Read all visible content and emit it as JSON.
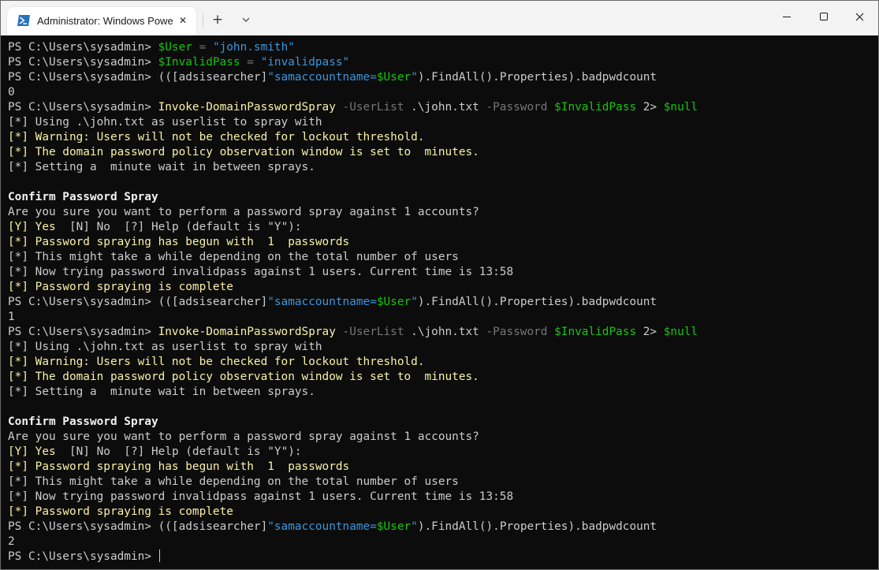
{
  "window": {
    "tab_title": "Administrator: Windows Powe",
    "new_tab_glyph": "+",
    "close_tab_glyph": "✕",
    "icons": [
      "powershell-icon",
      "close-icon",
      "plus-icon",
      "chevron-down-icon",
      "minimize-icon",
      "maximize-icon",
      "close-icon"
    ]
  },
  "terminal": {
    "lines": [
      [
        {
          "t": "PS C:\\Users\\sysadmin> ",
          "c": "default"
        },
        {
          "t": "$User",
          "c": "var"
        },
        {
          "t": " = ",
          "c": "op"
        },
        {
          "t": "\"john.smith\"",
          "c": "str"
        }
      ],
      [
        {
          "t": "PS C:\\Users\\sysadmin> ",
          "c": "default"
        },
        {
          "t": "$InvalidPass",
          "c": "var"
        },
        {
          "t": " = ",
          "c": "op"
        },
        {
          "t": "\"invalidpass\"",
          "c": "str"
        }
      ],
      [
        {
          "t": "PS C:\\Users\\sysadmin> (([adsisearcher]",
          "c": "default"
        },
        {
          "t": "\"samaccountname=",
          "c": "str"
        },
        {
          "t": "$User",
          "c": "var"
        },
        {
          "t": "\"",
          "c": "str"
        },
        {
          "t": ").FindAll().Properties).badpwdcount",
          "c": "default"
        }
      ],
      [
        {
          "t": "0",
          "c": "default"
        }
      ],
      [
        {
          "t": "PS C:\\Users\\sysadmin> ",
          "c": "default"
        },
        {
          "t": "Invoke-DomainPasswordSpray",
          "c": "cmd"
        },
        {
          "t": " -UserList",
          "c": "param"
        },
        {
          "t": " .\\john.txt ",
          "c": "default"
        },
        {
          "t": "-Password",
          "c": "param"
        },
        {
          "t": " ",
          "c": "default"
        },
        {
          "t": "$InvalidPass",
          "c": "var"
        },
        {
          "t": " 2> ",
          "c": "default"
        },
        {
          "t": "$null",
          "c": "var"
        }
      ],
      [
        {
          "t": "[*] Using .\\john.txt as userlist to spray with",
          "c": "default"
        }
      ],
      [
        {
          "t": "[*] Warning: Users will not be checked for lockout threshold.",
          "c": "warn"
        }
      ],
      [
        {
          "t": "[*] The domain password policy observation window is set to  minutes.",
          "c": "warn"
        }
      ],
      [
        {
          "t": "[*] Setting a  minute wait in between sprays.",
          "c": "default"
        }
      ],
      [
        {
          "t": "",
          "c": "default"
        }
      ],
      [
        {
          "t": "Confirm Password Spray",
          "c": "bold"
        }
      ],
      [
        {
          "t": "Are you sure you want to perform a password spray against 1 accounts?",
          "c": "default"
        }
      ],
      [
        {
          "t": "[Y] Yes  ",
          "c": "warn"
        },
        {
          "t": "[N] No  [?] Help (default is \"Y\"):",
          "c": "default"
        }
      ],
      [
        {
          "t": "[*] Password spraying has begun with  1  passwords",
          "c": "warn"
        }
      ],
      [
        {
          "t": "[*] This might take a while depending on the total number of users",
          "c": "default"
        }
      ],
      [
        {
          "t": "[*] Now trying password invalidpass against 1 users. Current time is 13:58",
          "c": "default"
        }
      ],
      [
        {
          "t": "[*] Password spraying is complete",
          "c": "warn"
        }
      ],
      [
        {
          "t": "PS C:\\Users\\sysadmin> (([adsisearcher]",
          "c": "default"
        },
        {
          "t": "\"samaccountname=",
          "c": "str"
        },
        {
          "t": "$User",
          "c": "var"
        },
        {
          "t": "\"",
          "c": "str"
        },
        {
          "t": ").FindAll().Properties).badpwdcount",
          "c": "default"
        }
      ],
      [
        {
          "t": "1",
          "c": "default"
        }
      ],
      [
        {
          "t": "PS C:\\Users\\sysadmin> ",
          "c": "default"
        },
        {
          "t": "Invoke-DomainPasswordSpray",
          "c": "cmd"
        },
        {
          "t": " -UserList",
          "c": "param"
        },
        {
          "t": " .\\john.txt ",
          "c": "default"
        },
        {
          "t": "-Password",
          "c": "param"
        },
        {
          "t": " ",
          "c": "default"
        },
        {
          "t": "$InvalidPass",
          "c": "var"
        },
        {
          "t": " 2> ",
          "c": "default"
        },
        {
          "t": "$null",
          "c": "var"
        }
      ],
      [
        {
          "t": "[*] Using .\\john.txt as userlist to spray with",
          "c": "default"
        }
      ],
      [
        {
          "t": "[*] Warning: Users will not be checked for lockout threshold.",
          "c": "warn"
        }
      ],
      [
        {
          "t": "[*] The domain password policy observation window is set to  minutes.",
          "c": "warn"
        }
      ],
      [
        {
          "t": "[*] Setting a  minute wait in between sprays.",
          "c": "default"
        }
      ],
      [
        {
          "t": "",
          "c": "default"
        }
      ],
      [
        {
          "t": "Confirm Password Spray",
          "c": "bold"
        }
      ],
      [
        {
          "t": "Are you sure you want to perform a password spray against 1 accounts?",
          "c": "default"
        }
      ],
      [
        {
          "t": "[Y] Yes  ",
          "c": "warn"
        },
        {
          "t": "[N] No  [?] Help (default is \"Y\"):",
          "c": "default"
        }
      ],
      [
        {
          "t": "[*] Password spraying has begun with  1  passwords",
          "c": "warn"
        }
      ],
      [
        {
          "t": "[*] This might take a while depending on the total number of users",
          "c": "default"
        }
      ],
      [
        {
          "t": "[*] Now trying password invalidpass against 1 users. Current time is 13:58",
          "c": "default"
        }
      ],
      [
        {
          "t": "[*] Password spraying is complete",
          "c": "warn"
        }
      ],
      [
        {
          "t": "PS C:\\Users\\sysadmin> (([adsisearcher]",
          "c": "default"
        },
        {
          "t": "\"samaccountname=",
          "c": "str"
        },
        {
          "t": "$User",
          "c": "var"
        },
        {
          "t": "\"",
          "c": "str"
        },
        {
          "t": ").FindAll().Properties).badpwdcount",
          "c": "default"
        }
      ],
      [
        {
          "t": "2",
          "c": "default"
        }
      ],
      [
        {
          "t": "PS C:\\Users\\sysadmin> ",
          "c": "default"
        }
      ]
    ]
  },
  "colors": {
    "background": "#0c0c0c",
    "default": "#cccccc",
    "variable": "#16c60c",
    "string": "#3a96dd",
    "command": "#f9f1a5",
    "parameter": "#767676",
    "warning": "#f9f1a5"
  }
}
